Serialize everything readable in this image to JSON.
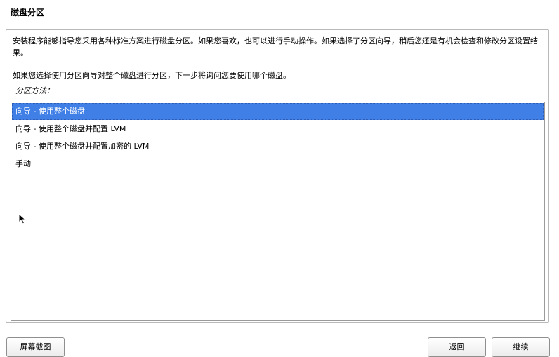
{
  "page": {
    "title": "磁盘分区"
  },
  "content": {
    "intro": "安装程序能够指导您采用各种标准方案进行磁盘分区。如果您喜欢，也可以进行手动操作。如果选择了分区向导，稍后您还是有机会检查和修改分区设置结果。",
    "question": "如果您选择使用分区向导对整个磁盘进行分区，下一步将询问您要使用哪个磁盘。",
    "method_label": "分区方法："
  },
  "methods": [
    {
      "label": "向导 - 使用整个磁盘",
      "selected": true
    },
    {
      "label": "向导 - 使用整个磁盘并配置 LVM",
      "selected": false
    },
    {
      "label": "向导 - 使用整个磁盘并配置加密的 LVM",
      "selected": false
    },
    {
      "label": "手动",
      "selected": false
    }
  ],
  "buttons": {
    "screenshot": "屏幕截图",
    "back": "返回",
    "continue": "继续"
  },
  "colors": {
    "selection": "#3f7fe6",
    "frame_border": "#b9b9b9"
  },
  "icons": {
    "cursor": "mouse-pointer-icon"
  }
}
